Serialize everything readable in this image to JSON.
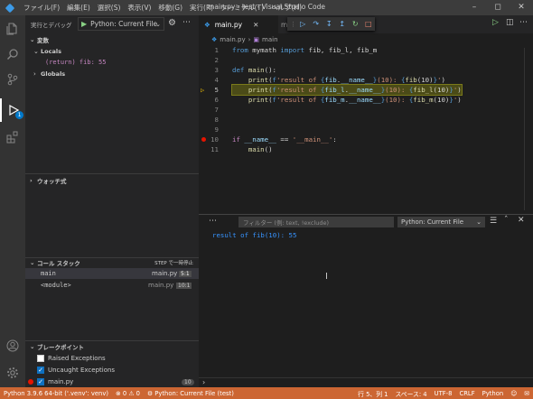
{
  "window": {
    "menu": [
      "ファイル(F)",
      "編集(E)",
      "選択(S)",
      "表示(V)",
      "移動(G)",
      "実行(R)",
      "ターミナル(T)",
      "ヘルプ(H)"
    ],
    "title": "main.py - test - Visual Studio Code"
  },
  "activity": {
    "debug_badge": "1"
  },
  "sidebar": {
    "run_label": "実行とデバッグ",
    "config": "Python: Current File",
    "variables": {
      "header": "変数",
      "locals": "Locals",
      "return_item": "(return) fib: 55",
      "globals": "Globals"
    },
    "watch": {
      "header": "ウォッチ式"
    },
    "callstack": {
      "header": "コール スタック",
      "status": "STEP で一時停止",
      "frames": [
        {
          "name": "main",
          "file": "main.py",
          "pos": "5:1"
        },
        {
          "name": "<module>",
          "file": "main.py",
          "pos": "10:1"
        }
      ]
    },
    "breakpoints": {
      "header": "ブレークポイント",
      "items": [
        {
          "label": "Raised Exceptions",
          "checked": false
        },
        {
          "label": "Uncaught Exceptions",
          "checked": true
        },
        {
          "label": "main.py",
          "checked": true,
          "count": "10"
        }
      ]
    }
  },
  "editor": {
    "tabs": [
      "main.py",
      "m"
    ],
    "breadcrumb": [
      "main.py",
      "main"
    ],
    "lines": [
      {
        "n": "1",
        "tokens": [
          [
            "kw",
            "from"
          ],
          [
            "op",
            " mymath "
          ],
          [
            "kw",
            "import"
          ],
          [
            "op",
            " fib, fib_l, fib_m"
          ]
        ]
      },
      {
        "n": "2",
        "tokens": []
      },
      {
        "n": "3",
        "tokens": [
          [
            "kw",
            "def"
          ],
          [
            "op",
            " "
          ],
          [
            "fn",
            "main"
          ],
          [
            "op",
            "():"
          ]
        ]
      },
      {
        "n": "4",
        "tokens": [
          [
            "op",
            "    "
          ],
          [
            "fn",
            "print"
          ],
          [
            "op",
            "("
          ],
          [
            "kw",
            "f"
          ],
          [
            "st",
            "'result of "
          ],
          [
            "kw",
            "{"
          ],
          [
            "va",
            "fib"
          ],
          [
            "op",
            "."
          ],
          [
            "va",
            "__name__"
          ],
          [
            "kw",
            "}"
          ],
          [
            "st",
            "(10): "
          ],
          [
            "kw",
            "{"
          ],
          [
            "fn",
            "fib"
          ],
          [
            "op",
            "(10)"
          ],
          [
            "kw",
            "}"
          ],
          [
            "st",
            "'"
          ],
          [
            "op",
            ")"
          ]
        ]
      },
      {
        "n": "5",
        "hl": true,
        "tokens": [
          [
            "op",
            "    "
          ],
          [
            "fn",
            "print"
          ],
          [
            "op",
            "("
          ],
          [
            "kw",
            "f"
          ],
          [
            "st",
            "'result of "
          ],
          [
            "kw",
            "{"
          ],
          [
            "va",
            "fib_l"
          ],
          [
            "op",
            "."
          ],
          [
            "va",
            "__name__"
          ],
          [
            "kw",
            "}"
          ],
          [
            "st",
            "(10): "
          ],
          [
            "kw",
            "{"
          ],
          [
            "fn",
            "fib_l"
          ],
          [
            "op",
            "(10)"
          ],
          [
            "kw",
            "}"
          ],
          [
            "st",
            "'"
          ],
          [
            "op",
            ")"
          ]
        ]
      },
      {
        "n": "6",
        "tokens": [
          [
            "op",
            "    "
          ],
          [
            "fn",
            "print"
          ],
          [
            "op",
            "("
          ],
          [
            "kw",
            "f"
          ],
          [
            "st",
            "'result of "
          ],
          [
            "kw",
            "{"
          ],
          [
            "va",
            "fib_m"
          ],
          [
            "op",
            "."
          ],
          [
            "va",
            "__name__"
          ],
          [
            "kw",
            "}"
          ],
          [
            "st",
            "(10): "
          ],
          [
            "kw",
            "{"
          ],
          [
            "fn",
            "fib_m"
          ],
          [
            "op",
            "(10)"
          ],
          [
            "kw",
            "}"
          ],
          [
            "st",
            "'"
          ],
          [
            "op",
            ")"
          ]
        ]
      },
      {
        "n": "7",
        "tokens": []
      },
      {
        "n": "8",
        "tokens": []
      },
      {
        "n": "9",
        "tokens": []
      },
      {
        "n": "10",
        "bp": true,
        "tokens": [
          [
            "ct",
            "if"
          ],
          [
            "op",
            " "
          ],
          [
            "va",
            "__name__"
          ],
          [
            "op",
            " == "
          ],
          [
            "st",
            "'__main__'"
          ],
          [
            "op",
            ":"
          ]
        ]
      },
      {
        "n": "11",
        "tokens": [
          [
            "op",
            "    "
          ],
          [
            "fn",
            "main"
          ],
          [
            "op",
            "()"
          ]
        ]
      }
    ]
  },
  "panel": {
    "filter_placeholder": "フィルター (例: text, !exclude)",
    "config": "Python: Current File",
    "output": "result of fib(10): 55"
  },
  "statusbar": {
    "interpreter": "Python 3.9.6 64-bit ('.venv': venv)",
    "errors": "0",
    "warnings": "0",
    "debug_config": "Python: Current File (test)",
    "position": "行 5、列 1",
    "spaces": "スペース: 4",
    "encoding": "UTF-8",
    "eol": "CRLF",
    "language": "Python"
  }
}
